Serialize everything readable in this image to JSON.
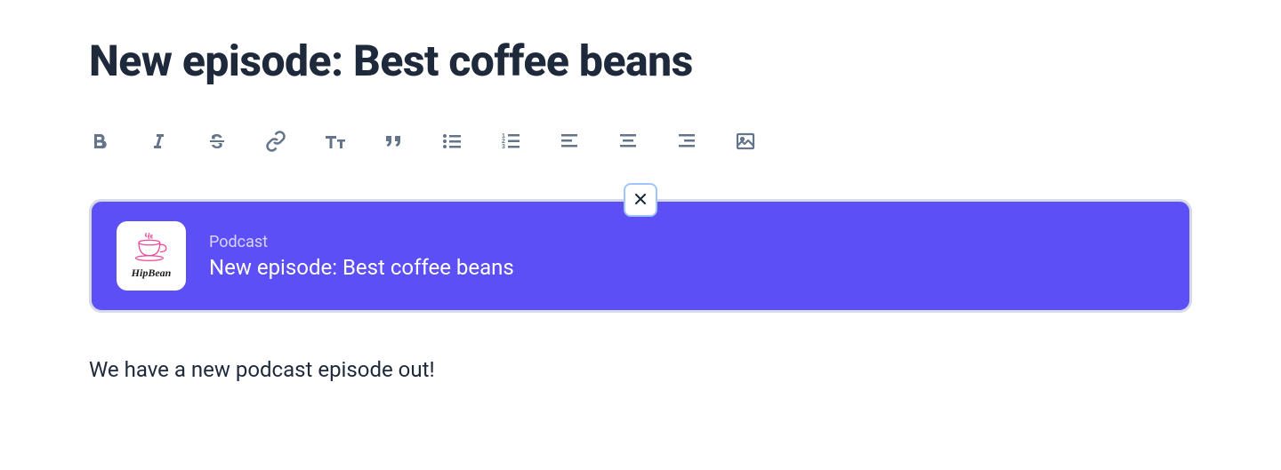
{
  "title": "New episode: Best coffee beans",
  "toolbar": {
    "buttons": [
      "bold",
      "italic",
      "strikethrough",
      "link",
      "text-size",
      "quote",
      "bullet-list",
      "numbered-list",
      "align-left",
      "align-center",
      "align-right",
      "image"
    ]
  },
  "embed": {
    "category": "Podcast",
    "title": "New episode: Best coffee beans",
    "brand": "HipBean"
  },
  "body": "We have a new podcast episode out!",
  "colors": {
    "accent": "#5b4ff5",
    "text": "#1e293b",
    "muted": "#64748b"
  }
}
